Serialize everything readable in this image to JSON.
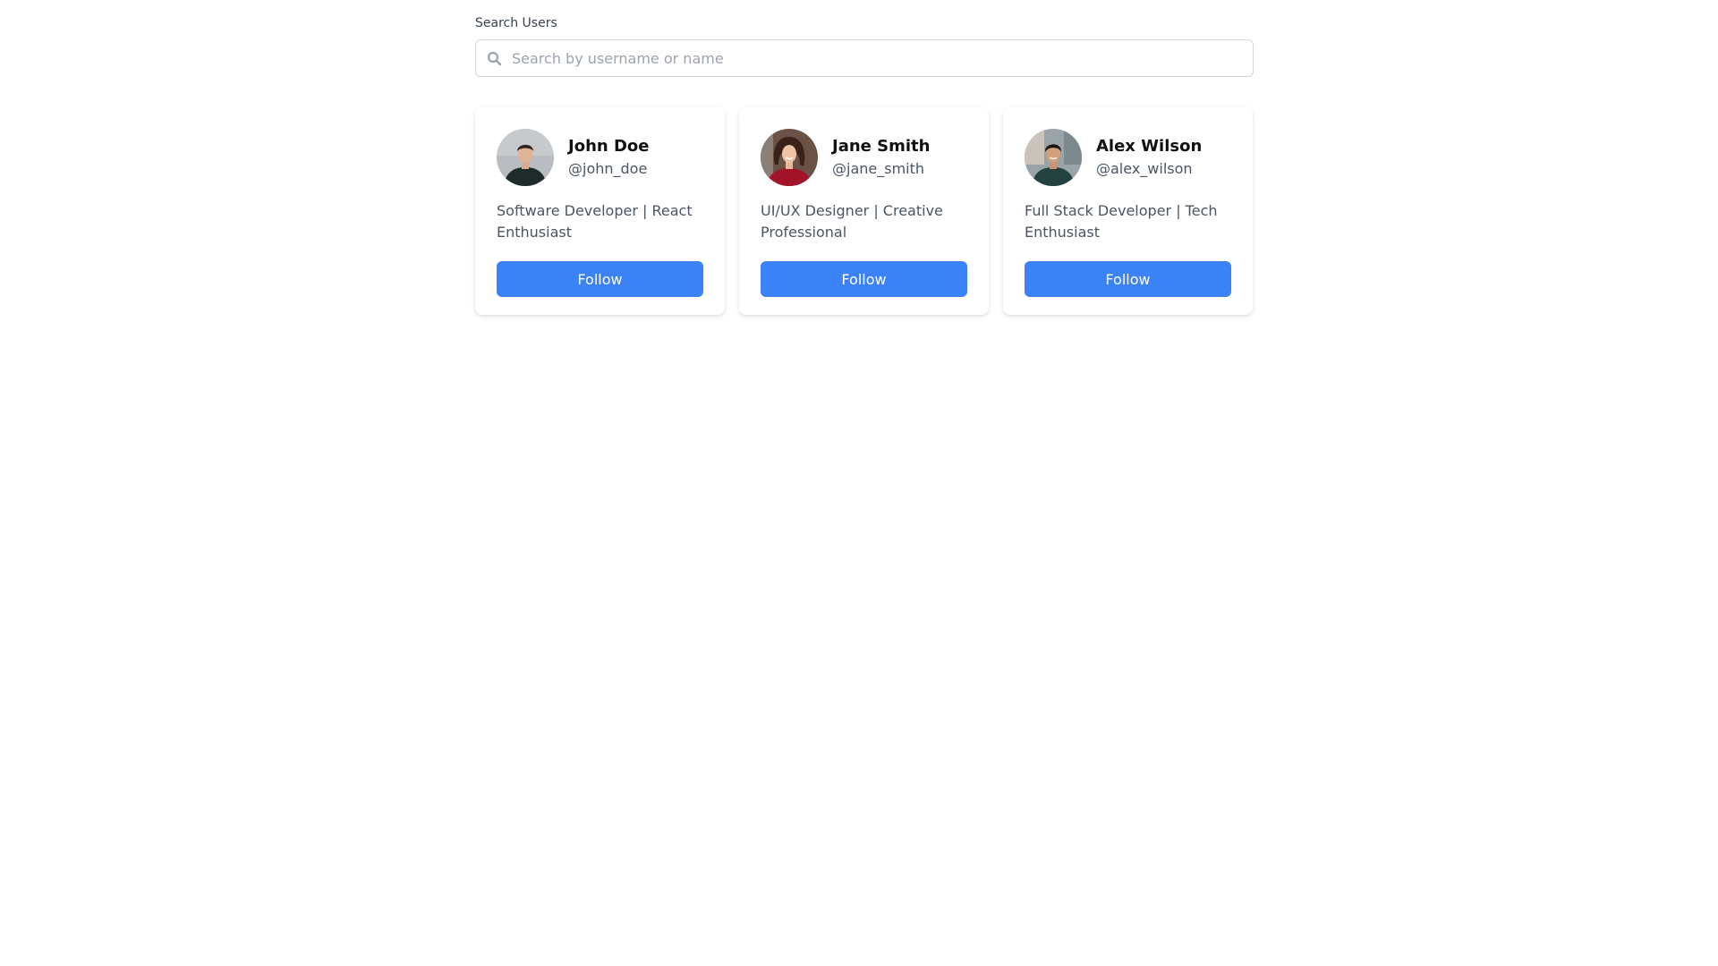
{
  "search": {
    "label": "Search Users",
    "placeholder": "Search by username or name",
    "value": "",
    "icon": "search-icon"
  },
  "users": [
    {
      "name": "John Doe",
      "handle": "@john_doe",
      "bio": "Software Developer | React Enthusiast",
      "follow_label": "Follow",
      "avatar": "avatar-photo"
    },
    {
      "name": "Jane Smith",
      "handle": "@jane_smith",
      "bio": "UI/UX Designer | Creative Professional",
      "follow_label": "Follow",
      "avatar": "avatar-photo"
    },
    {
      "name": "Alex Wilson",
      "handle": "@alex_wilson",
      "bio": "Full Stack Developer | Tech Enthusiast",
      "follow_label": "Follow",
      "avatar": "avatar-photo"
    }
  ],
  "colors": {
    "accent": "#3b82f6",
    "border": "#d1d5db",
    "muted_text": "#4b5563"
  }
}
